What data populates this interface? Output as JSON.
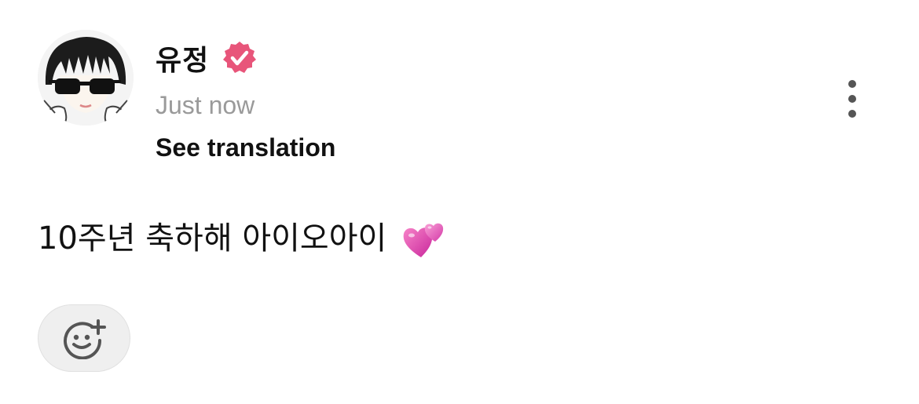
{
  "post": {
    "author": {
      "name": "유정",
      "verified": true,
      "verified_color": "#e8557a"
    },
    "timestamp": "Just now",
    "translate_label": "See translation",
    "text": "10주년 축하해 아이오아이",
    "emoji": "two-hearts-icon",
    "actions": {
      "more": "more-options-icon",
      "react": "add-reaction-icon"
    }
  }
}
